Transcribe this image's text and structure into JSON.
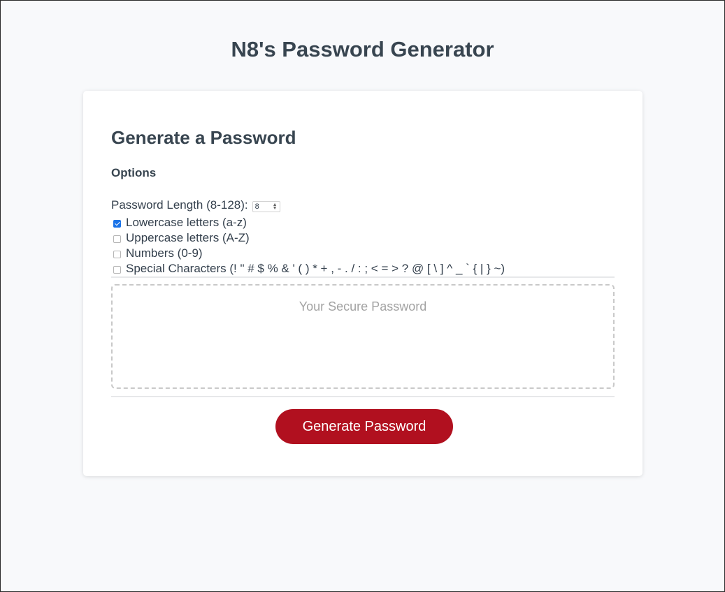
{
  "page": {
    "title": "N8's Password Generator"
  },
  "card": {
    "header": "Generate a Password",
    "options_title": "Options",
    "length": {
      "label": "Password Length (8-128):",
      "value": "8",
      "spinner_up": "▲",
      "spinner_down": "▼"
    },
    "options": [
      {
        "label": "Lowercase letters (a-z)",
        "checked": true
      },
      {
        "label": "Uppercase letters (A-Z)",
        "checked": false
      },
      {
        "label": "Numbers (0-9)",
        "checked": false
      },
      {
        "label": "Special Characters (! \" # $ % & ' ( ) * + , - . / : ; < = > ? @ [ \\ ] ^ _ ` { | } ~)",
        "checked": false
      }
    ],
    "password_placeholder": "Your Secure Password",
    "generate_button": "Generate Password"
  },
  "colors": {
    "button": "#b1101f",
    "checkbox_checked": "#1a73e8",
    "text": "#384550"
  }
}
